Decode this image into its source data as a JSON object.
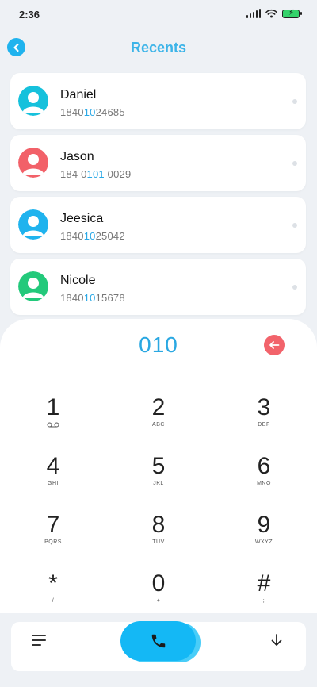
{
  "status_bar": {
    "time": "2:36"
  },
  "header": {
    "title": "Recents"
  },
  "contacts": [
    {
      "name": "Daniel",
      "number_pre": "1840",
      "number_match": "10",
      "number_post": "24685",
      "avatar_color": "#16c1dc"
    },
    {
      "name": "Jason",
      "number_pre": "184 0",
      "number_match": "101",
      "number_post": " 0029",
      "avatar_color": "#f26169"
    },
    {
      "name": "Jeesica",
      "number_pre": "1840",
      "number_match": "10",
      "number_post": "25042",
      "avatar_color": "#1fb3ee"
    },
    {
      "name": "Nicole",
      "number_pre": "1840",
      "number_match": "10",
      "number_post": "15678",
      "avatar_color": "#23c97b"
    }
  ],
  "dialer": {
    "dialed": "010",
    "keys": [
      {
        "digit": "1",
        "letters": ""
      },
      {
        "digit": "2",
        "letters": "ABC"
      },
      {
        "digit": "3",
        "letters": "DEF"
      },
      {
        "digit": "4",
        "letters": "GHI"
      },
      {
        "digit": "5",
        "letters": "JKL"
      },
      {
        "digit": "6",
        "letters": "MNO"
      },
      {
        "digit": "7",
        "letters": "PQRS"
      },
      {
        "digit": "8",
        "letters": "TUV"
      },
      {
        "digit": "9",
        "letters": "WXYZ"
      },
      {
        "digit": "*",
        "letters": "/"
      },
      {
        "digit": "0",
        "letters": "+"
      },
      {
        "digit": "#",
        "letters": ";"
      }
    ]
  },
  "colors": {
    "accent": "#2aa8e2",
    "call_button": "#14b8f5",
    "delete_button": "#f2636b"
  },
  "icons": {
    "back": "chevron-left-icon",
    "delete": "arrow-left-icon",
    "voicemail": "voicemail-icon",
    "menu": "menu-icon",
    "call": "phone-icon",
    "collapse": "arrow-down-icon"
  }
}
